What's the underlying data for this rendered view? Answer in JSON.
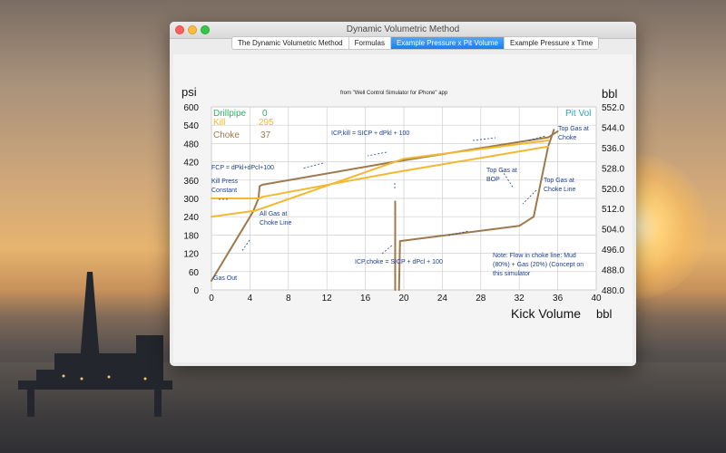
{
  "window": {
    "title": "Dynamic Volumetric Method",
    "tabs": [
      {
        "label": "The Dynamic Volumetric Method",
        "active": false
      },
      {
        "label": "Formulas",
        "active": false
      },
      {
        "label": "Example Pressure x Pit Volume",
        "active": true
      },
      {
        "label": "Example Pressure x Time",
        "active": false
      }
    ]
  },
  "chart_data": {
    "type": "line",
    "title": "from \"Well Control Simulator for iPhone\" app",
    "xlabel": "Kick Volume",
    "x_unit": "bbl",
    "ylabel_left": "psi",
    "ylabel_right": "bbl",
    "x_ticks": [
      "0",
      "4",
      "8",
      "12",
      "16",
      "20",
      "24",
      "28",
      "32",
      "36",
      "40"
    ],
    "y_ticks_left": [
      "0",
      "60",
      "120",
      "180",
      "240",
      "300",
      "360",
      "420",
      "480",
      "540",
      "600"
    ],
    "y_ticks_right": [
      "480.0",
      "488.0",
      "496.0",
      "504.0",
      "512.0",
      "520.0",
      "528.0",
      "536.0",
      "544.0",
      "552.0"
    ],
    "xlim": [
      0,
      40
    ],
    "ylim_left": [
      0,
      600
    ],
    "ylim_right": [
      480,
      552
    ],
    "grid": true,
    "colors": {
      "drillpipe": "#2fb06a",
      "kill": "#f2b830",
      "choke": "#9c7a4c",
      "pit_vol": "#2aa3b8",
      "annotation": "#1c3f8f",
      "arrow": "#c98a3a"
    },
    "legend_items": [
      {
        "label": "Drillpipe",
        "value": "0",
        "color": "#2fb06a"
      },
      {
        "label": "Kill",
        "value": "295",
        "color": "#f2b830"
      },
      {
        "label": "Choke",
        "value": "37",
        "color": "#9c7a4c"
      }
    ],
    "right_legend": "Pit Vol",
    "series": [
      {
        "key": "choke",
        "color": "#9c7a4c",
        "x": [
          0,
          4.3,
          4.9,
          5.0,
          5.3,
          19.0,
          35.0,
          36.0
        ],
        "y": [
          30,
          255,
          300,
          340,
          345,
          420,
          500,
          520
        ]
      },
      {
        "key": "choke_second",
        "color": "#9c7a4c",
        "x": [
          19.5,
          19.6,
          32,
          33.5,
          35.0,
          35.6
        ],
        "y": [
          0,
          160,
          210,
          240,
          470,
          525
        ]
      },
      {
        "key": "kill",
        "color": "#f2b830",
        "x": [
          0,
          5.0,
          5.3,
          19.0,
          35.0
        ],
        "y": [
          300,
          300,
          305,
          385,
          470
        ]
      },
      {
        "key": "kill_second",
        "color": "#f2b830",
        "x": [
          0,
          4.6,
          20,
          35
        ],
        "y": [
          240,
          260,
          430,
          490
        ]
      },
      {
        "key": "pit_vol_vertical",
        "color": "#9c7a4c",
        "x": [
          19.1,
          19.1
        ],
        "y": [
          0,
          290
        ]
      }
    ],
    "annotations": [
      "ICP,kill = SICP + dPkl + 100",
      "FCP = dPkl+dPcl+100",
      "Kill Press Constant",
      "All Gas at Choke Line",
      "Gas Out",
      "ICP,choke = SICP + dPcl + 100",
      "Top Gas at BOP",
      "Top Gas at Choke Line",
      "Top Gas at Choke",
      "Note: Flow in choke line: Mud (80%) + Gas (20%) (Concept on this simulator"
    ]
  }
}
